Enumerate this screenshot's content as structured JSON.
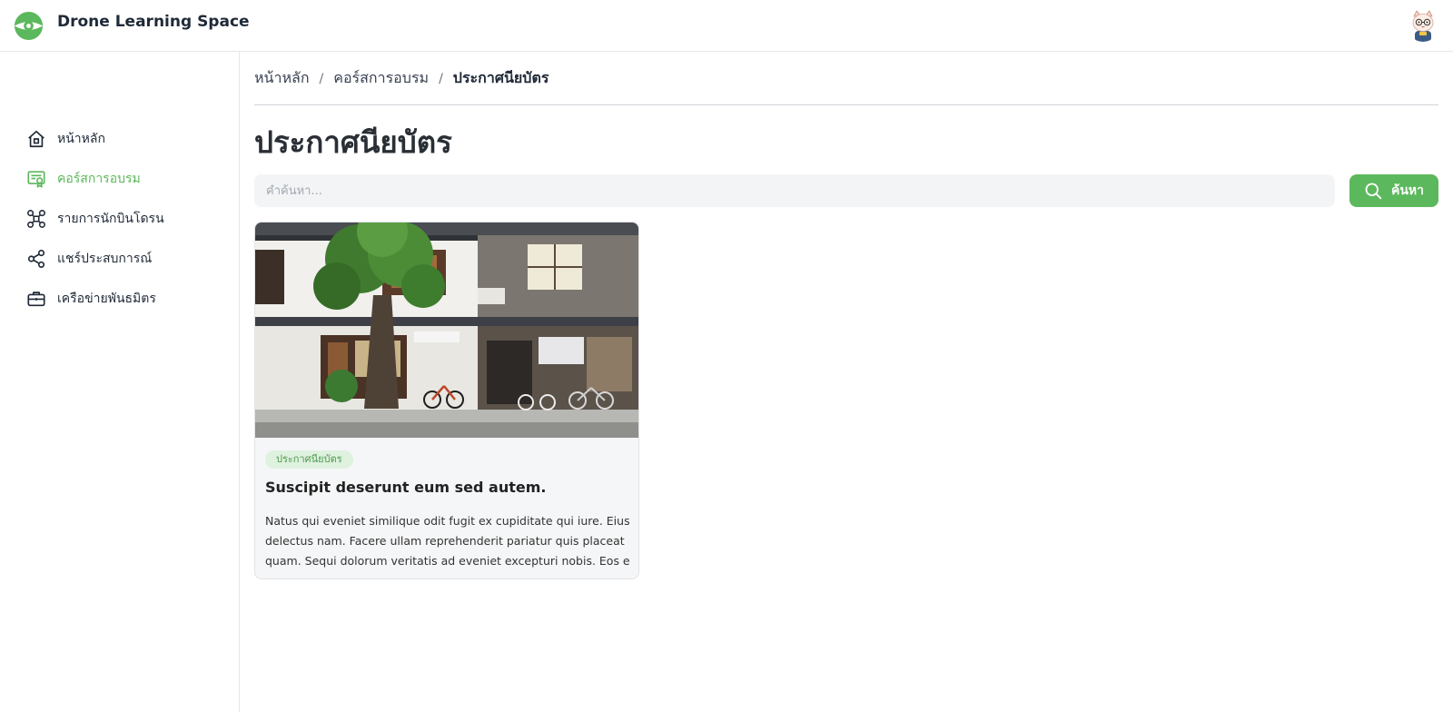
{
  "app": {
    "name": "Drone Learning Space",
    "logo_icon": "drone-eye-logo-icon",
    "avatar_icon": "cat-avatar-icon"
  },
  "sidebar": {
    "items": [
      {
        "label": "หน้าหลัก",
        "icon": "home-icon",
        "active": false
      },
      {
        "label": "คอร์สการอบรม",
        "icon": "certificate-icon",
        "active": true
      },
      {
        "label": "รายการนักบินโดรน",
        "icon": "drone-icon",
        "active": false
      },
      {
        "label": "แชร์ประสบการณ์",
        "icon": "share-icon",
        "active": false
      },
      {
        "label": "เครือข่ายพันธมิตร",
        "icon": "briefcase-icon",
        "active": false
      }
    ]
  },
  "breadcrumb": {
    "items": [
      "หน้าหลัก",
      "คอร์สการอบรม",
      "ประกาศนียบัตร"
    ],
    "separator": "/"
  },
  "page": {
    "title": "ประกาศนียบัตร"
  },
  "search": {
    "placeholder": "คำค้นหา...",
    "value": "",
    "button_label": "ค้นหา",
    "button_icon": "search-icon"
  },
  "cards": [
    {
      "image": "street-storefront-photo",
      "tag": "ประกาศนียบัตร",
      "title": "Suscipit deserunt eum sed autem.",
      "description_lines": [
        "Natus qui eveniet similique odit fugit ex cupiditate qui iure. Eius",
        "delectus nam. Facere ullam reprehenderit pariatur quis placeat",
        "quam. Sequi dolorum veritatis ad eveniet excepturi nobis. Eos eiu..."
      ]
    }
  ],
  "colors": {
    "accent": "#5cb85c",
    "tag_bg": "#dff1df",
    "tag_text": "#4f9a4f",
    "input_bg": "#f3f4f6"
  }
}
